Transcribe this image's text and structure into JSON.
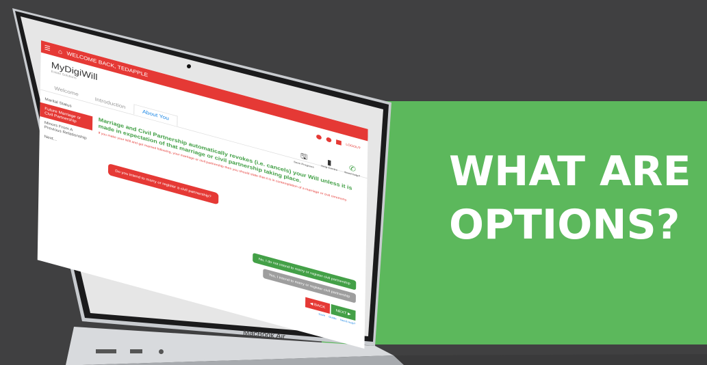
{
  "promo": {
    "title_line1": "WHAT ARE",
    "title_line2": "OPTIONS?",
    "bg_color": "#5cb85c"
  },
  "laptop": {
    "model_label": "MacBook Air"
  },
  "app": {
    "topbar": {
      "menu_icon": "hamburger-icon",
      "home_icon": "home-icon",
      "welcome": "WELCOME BACK, TEDAPPLE"
    },
    "brand": {
      "name": "MyDigiWill",
      "tagline": "Estate Solutions",
      "right_label": "LOGOUT"
    },
    "tabs": [
      "Welcome",
      "Introduction",
      "About You"
    ],
    "active_tab": "About You",
    "sidebar": [
      {
        "label": "Marital Status",
        "selected": false
      },
      {
        "label": "Future Marriage or Civil Partnership",
        "selected": true
      },
      {
        "label": "Minors From A Previous Relationship",
        "selected": false
      },
      {
        "label": "Next...",
        "selected": false
      }
    ],
    "tools": [
      {
        "icon": "save-progress-icon",
        "label": "Save Progress"
      },
      {
        "icon": "help-icon",
        "label": "Help Centre"
      },
      {
        "icon": "phone-icon",
        "label": "Need help?"
      }
    ],
    "heading": "Marriage and Civil Partnership automatically revokes (i.e. cancels) your Will unless it is made in expectation of that marriage or civil partnership taking place.",
    "note": "If you make your Will and get married following, your marriage or civil partnership then you should state that it is in contemplation of a marriage or civil ceremony.",
    "question": "Do you intend to marry or register a civil partnership?",
    "answers": [
      "No, I do not intend to marry or register civil partnership",
      "Yes, I intend to marry or register civil partnership"
    ],
    "nav": {
      "back": "BACK",
      "next": "NEXT"
    },
    "footer": [
      "Save",
      "Guide",
      "Need Help?"
    ],
    "accent_red": "#e53935",
    "accent_green": "#43a047"
  }
}
